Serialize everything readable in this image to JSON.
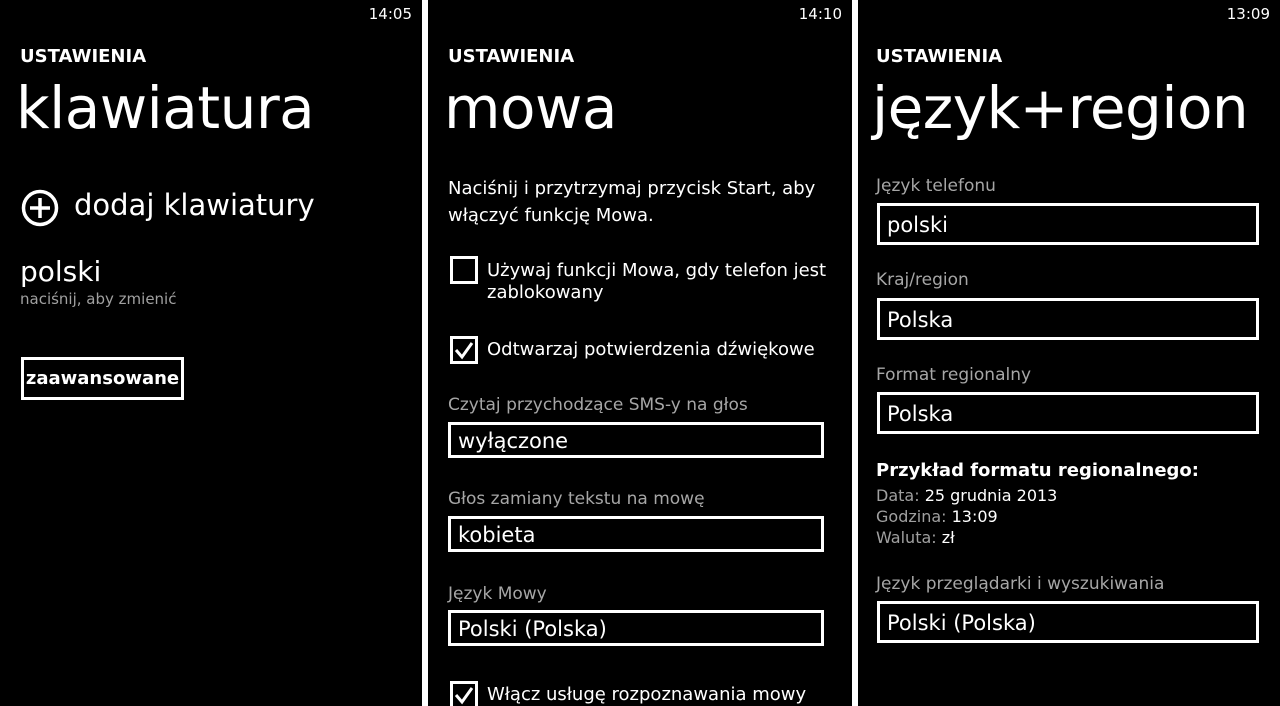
{
  "keyboard_screen": {
    "clock": "14:05",
    "app_title": "USTAWIENIA",
    "page_title": "klawiatura",
    "add_label": "dodaj klawiatury",
    "keyboard_name": "polski",
    "keyboard_hint": "naciśnij, aby zmienić",
    "advanced_button": "zaawansowane"
  },
  "speech_screen": {
    "clock": "14:10",
    "app_title": "USTAWIENIA",
    "page_title": "mowa",
    "intro_line1": "Naciśnij i przytrzymaj przycisk Start, aby",
    "intro_line2": "włączyć funkcję Mowa.",
    "checkbox_locked": {
      "line1": "Używaj funkcji Mowa, gdy telefon jest",
      "line2": "zablokowany",
      "checked": false
    },
    "checkbox_confirm": {
      "label": "Odtwarzaj potwierdzenia dźwiękowe",
      "checked": true
    },
    "sms_label": "Czytaj przychodzące SMS-y na głos",
    "sms_value": "wyłączone",
    "voice_label": "Głos zamiany tekstu na mowę",
    "voice_value": "kobieta",
    "language_label": "Język Mowy",
    "language_value": "Polski (Polska)",
    "checkbox_recognition": {
      "label": "Włącz usługę rozpoznawania mowy",
      "checked": true
    }
  },
  "region_screen": {
    "clock": "13:09",
    "app_title": "USTAWIENIA",
    "page_title": "język+region",
    "phone_lang_label": "Język telefonu",
    "phone_lang_value": "polski",
    "country_label": "Kraj/region",
    "country_value": "Polska",
    "format_label": "Format regionalny",
    "format_value": "Polska",
    "example_title": "Przykład formatu regionalnego:",
    "example_date_label": "Data:",
    "example_date_value": "25 grudnia 2013",
    "example_time_label": "Godzina:",
    "example_time_value": "13:09",
    "example_currency_label": "Waluta:",
    "example_currency_value": "zł",
    "browser_lang_label": "Język przeglądarki i wyszukiwania",
    "browser_lang_value": "Polski (Polska)"
  }
}
